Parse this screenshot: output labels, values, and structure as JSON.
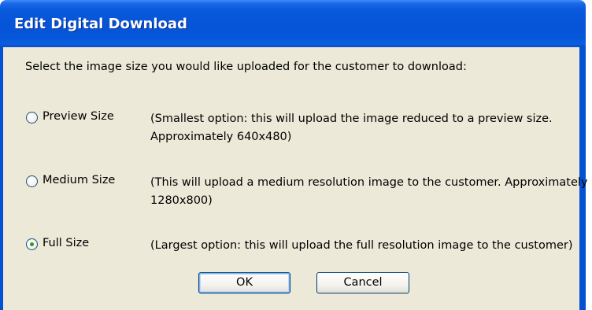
{
  "dialog": {
    "title": "Edit Digital Download",
    "prompt": "Select the image size you would like uploaded for the customer to download:"
  },
  "options": [
    {
      "label": "Preview Size",
      "description": "(Smallest option: this will upload the image reduced to a preview size. Approximately 640x480)",
      "selected": false
    },
    {
      "label": "Medium Size",
      "description": "(This will upload a medium resolution image to the customer. Approximately 1280x800)",
      "selected": false
    },
    {
      "label": "Full Size",
      "description": "(Largest option: this will upload the full resolution image to the customer)",
      "selected": true
    }
  ],
  "buttons": {
    "ok_label": "OK",
    "cancel_label": "Cancel"
  },
  "colors": {
    "titlebar": "#0654d8",
    "dialog_background": "#ece9d8",
    "radio_dot": "#21a121",
    "button_border": "#003c74"
  }
}
